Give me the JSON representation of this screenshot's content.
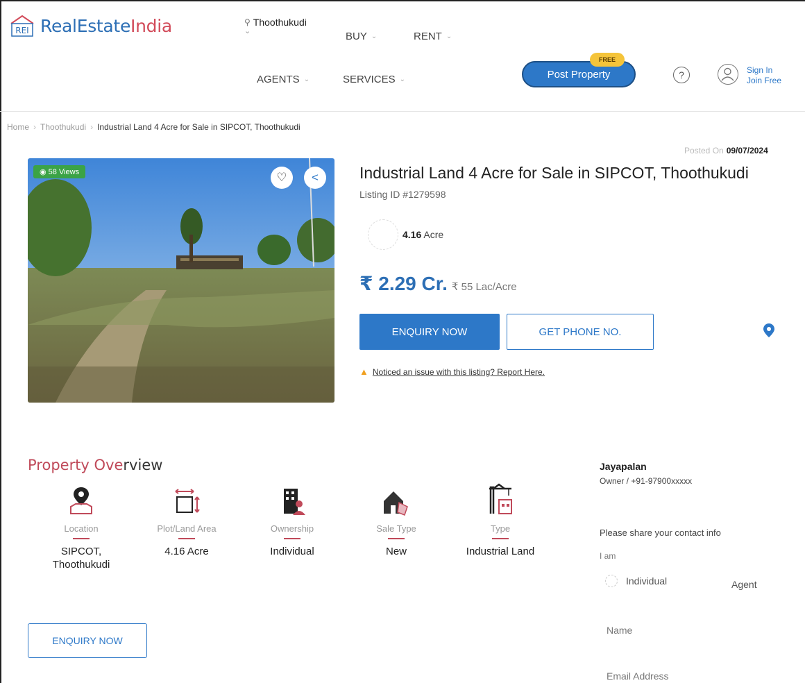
{
  "header": {
    "logo_mark": "REI",
    "brand_a": "RealEstate",
    "brand_b": "India",
    "city": "Thoothukudi",
    "nav": {
      "buy": "BUY",
      "rent": "RENT",
      "agents": "AGENTS",
      "services": "SERVICES"
    },
    "post_property": "Post Property",
    "free_badge": "FREE",
    "sign_in": "Sign In",
    "join_free": "Join Free"
  },
  "breadcrumb": [
    "Home",
    "Thoothukudi",
    "Industrial Land 4 Acre for Sale in SIPCOT, Thoothukudi"
  ],
  "listing": {
    "views": "58 Views",
    "posted_label": "Posted On",
    "posted_date": "09/07/2024",
    "title": "Industrial Land 4 Acre for Sale in SIPCOT, Thoothukudi",
    "listing_id": "Listing ID #1279598",
    "area_value": "4.16",
    "area_unit": "Acre",
    "price": "₹ 2.29 Cr.",
    "price_per": "₹ 55 Lac/Acre",
    "enquiry": "ENQUIRY NOW",
    "get_phone": "GET PHONE NO.",
    "report": "Noticed an issue with this listing? Report Here."
  },
  "overview": {
    "title_a": "Property Ove",
    "title_b": "rview",
    "items": [
      {
        "label": "Location",
        "value": "SIPCOT, Thoothukudi",
        "icon": "location-pin-icon"
      },
      {
        "label": "Plot/Land Area",
        "value": "4.16 Acre",
        "icon": "plot-area-icon"
      },
      {
        "label": "Ownership",
        "value": "Individual",
        "icon": "ownership-building-icon"
      },
      {
        "label": "Sale Type",
        "value": "New",
        "icon": "house-tag-icon"
      },
      {
        "label": "Type",
        "value": "Industrial Land",
        "icon": "crane-building-icon"
      }
    ],
    "enquiry": "ENQUIRY NOW"
  },
  "contact": {
    "name": "Jayapalan",
    "info": "Owner / +91-97900xxxxx",
    "share": "Please share your contact info",
    "i_am": "I am",
    "opt_individual": "Individual",
    "opt_agent": "Agent",
    "name_placeholder": "Name",
    "email_placeholder": "Email Address"
  },
  "colors": {
    "brand_blue": "#2d78c8",
    "brand_red": "#c04a5a",
    "views_green": "#3ba346"
  }
}
